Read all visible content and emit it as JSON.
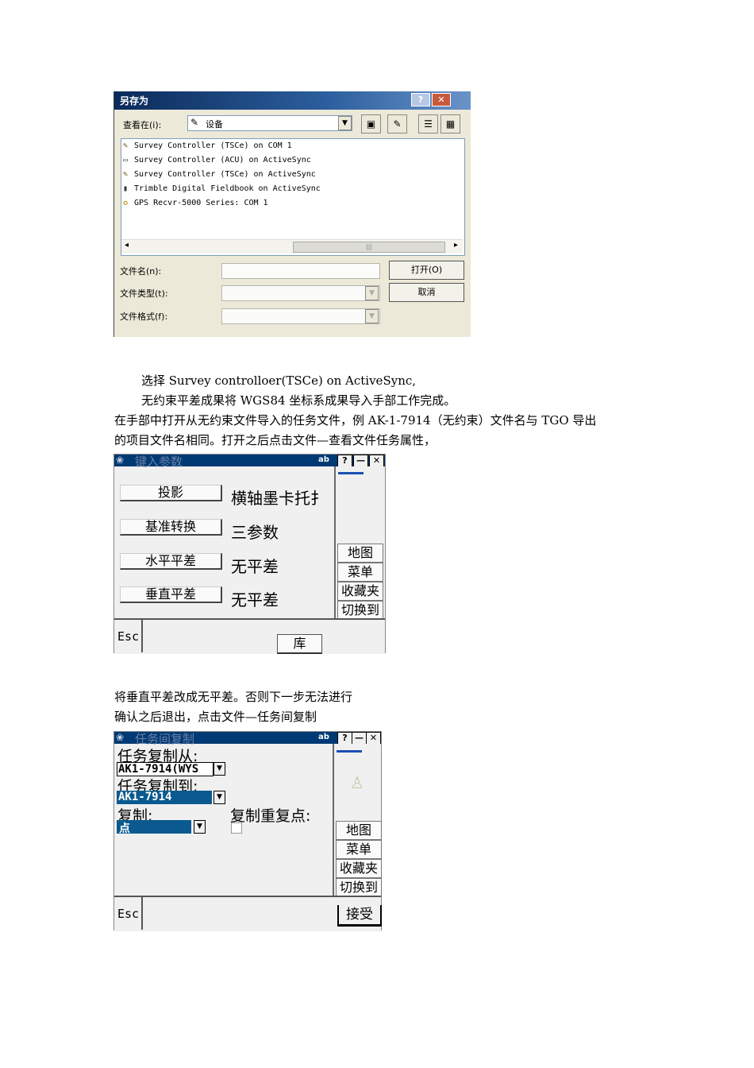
{
  "save_dialog": {
    "title": "另存为",
    "help_btn": "?",
    "close_btn": "✕",
    "look_in_label": "查看在(i):",
    "look_in_value": "设备",
    "files": [
      {
        "icon": "wand-icon",
        "label": "Survey Controller (TSCe) on COM 1"
      },
      {
        "icon": "device-icon",
        "label": "Survey Controller (ACU) on ActiveSync"
      },
      {
        "icon": "wand-icon",
        "label": "Survey Controller (TSCe) on ActiveSync"
      },
      {
        "icon": "book-icon",
        "label": "Trimble Digital Fieldbook on ActiveSync"
      },
      {
        "icon": "gps-icon",
        "label": "GPS Recvr-5000 Series: COM 1"
      }
    ],
    "filename_label": "文件名(n):",
    "filetype_label": "文件类型(t):",
    "fileformat_label": "文件格式(f):",
    "open_button": "打开(O)",
    "cancel_button": "取消"
  },
  "text": {
    "p1": "选择 Survey controlloer(TSCe) on ActiveSync,",
    "p2": "无约束平差成果将 WGS84 坐标系成果导入手部工作完成。",
    "p3": "在手部中打开从无约束文件导入的任务文件，例 AK-1-7914（无约束）文件名与 TGO 导出",
    "p4": "的项目文件名相同。打开之后点击文件—查看文件任务属性，",
    "p5": "将垂直平差改成无平差。否则下一步无法进行",
    "p6": "确认之后退出，点击文件—任务间复制"
  },
  "screen1": {
    "title": "键入参数",
    "ab": "ab",
    "help": "?",
    "minimize": "—",
    "close": "✕",
    "rows": [
      {
        "button": "投影",
        "value": "横轴墨卡托扌"
      },
      {
        "button": "基准转换",
        "value": "三参数"
      },
      {
        "button": "水平平差",
        "value": "无平差"
      },
      {
        "button": "垂直平差",
        "value": "无平差"
      }
    ],
    "nav": [
      "地图",
      "菜单",
      "收藏夹",
      "切换到"
    ],
    "esc": "Esc",
    "library": "库"
  },
  "screen2": {
    "title": "任务间复制",
    "ab": "ab",
    "help": "?",
    "minimize": "—",
    "close": "✕",
    "copy_from_label": "任务复制从:",
    "copy_from_value": "AK1-7914(WYS",
    "copy_to_label": "任务复制到:",
    "copy_to_value": "AK1-7914",
    "copy_label": "复制:",
    "copy_value": "点",
    "dup_label": "复制重复点:",
    "nav": [
      "地图",
      "菜单",
      "收藏夹",
      "切换到"
    ],
    "esc": "Esc",
    "accept": "接受"
  }
}
